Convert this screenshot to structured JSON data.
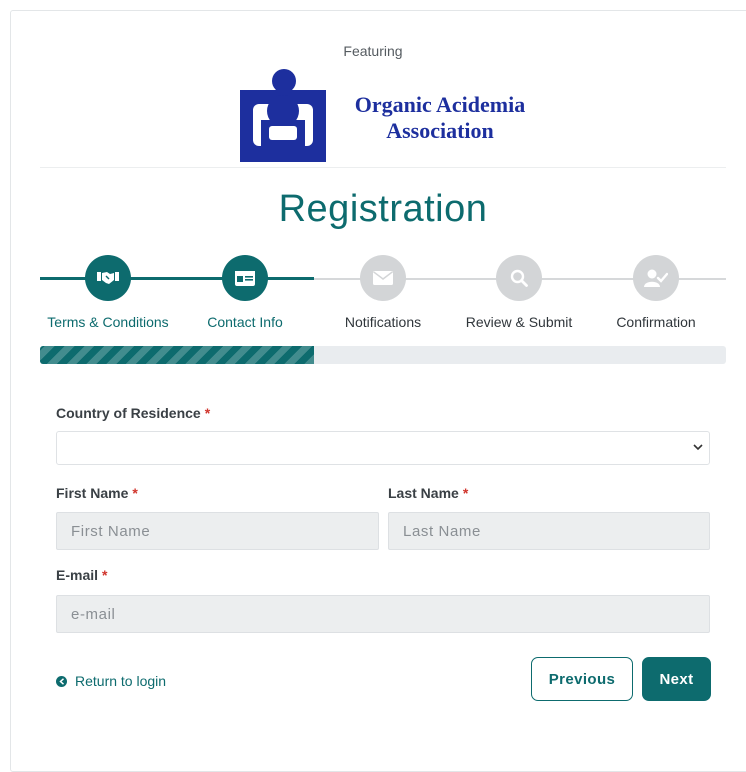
{
  "header": {
    "featuring": "Featuring",
    "logo_line1": "Organic Acidemia",
    "logo_line2": "Association",
    "title": "Registration"
  },
  "steps": [
    {
      "label": "Terms & Conditions",
      "icon": "handshake-icon",
      "state": "done"
    },
    {
      "label": "Contact Info",
      "icon": "id-card-icon",
      "state": "done"
    },
    {
      "label": "Notifications",
      "icon": "envelope-icon",
      "state": "pending"
    },
    {
      "label": "Review & Submit",
      "icon": "search-icon",
      "state": "pending"
    },
    {
      "label": "Confirmation",
      "icon": "user-check-icon",
      "state": "pending"
    }
  ],
  "progress": {
    "percent": 40
  },
  "form": {
    "country_label": "Country of Residence",
    "country_value": "",
    "first_name_label": "First Name",
    "first_name_placeholder": "First Name",
    "last_name_label": "Last Name",
    "last_name_placeholder": "Last Name",
    "email_label": "E-mail",
    "email_placeholder": "e-mail",
    "required_mark": "*"
  },
  "footer": {
    "return_label": "Return to login",
    "previous_label": "Previous",
    "next_label": "Next"
  },
  "colors": {
    "accent": "#0d6b6e",
    "inactive": "#d3d5d7",
    "required": "#d0342c",
    "logo_blue": "#1d2f9e"
  }
}
